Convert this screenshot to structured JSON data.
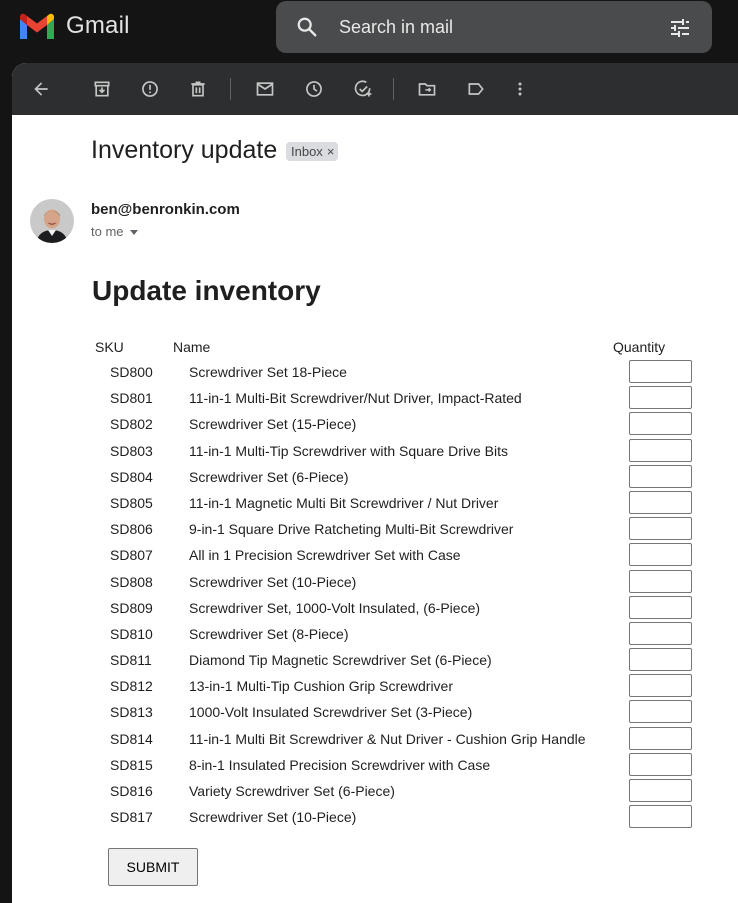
{
  "app": {
    "name": "Gmail",
    "brand_colors": [
      "#ea4335",
      "#4285f4",
      "#34a853",
      "#fbbc04",
      "#c5221f"
    ]
  },
  "search": {
    "placeholder": "Search in mail",
    "icon": "search-icon",
    "filter_icon": "tune-icon"
  },
  "toolbar": {
    "icons": [
      "back-arrow-icon",
      "archive-icon",
      "report-spam-icon",
      "delete-icon",
      "mark-unread-icon",
      "snooze-icon",
      "add-to-tasks-icon",
      "move-to-icon",
      "label-icon",
      "more-vert-icon"
    ]
  },
  "email": {
    "subject": "Inventory update",
    "label_chip": "Inbox",
    "label_chip_close": "×",
    "sender": "ben@benronkin.com",
    "recipient": "to me"
  },
  "form": {
    "heading": "Update inventory",
    "columns": {
      "sku": "SKU",
      "name": "Name",
      "quantity": "Quantity"
    },
    "items": [
      {
        "sku": "SD800",
        "name": "Screwdriver Set 18-Piece",
        "quantity": ""
      },
      {
        "sku": "SD801",
        "name": "11-in-1 Multi-Bit Screwdriver/Nut Driver, Impact-Rated",
        "quantity": ""
      },
      {
        "sku": "SD802",
        "name": "Screwdriver Set (15-Piece)",
        "quantity": ""
      },
      {
        "sku": "SD803",
        "name": "11-in-1 Multi-Tip Screwdriver with Square Drive Bits",
        "quantity": ""
      },
      {
        "sku": "SD804",
        "name": "Screwdriver Set (6-Piece)",
        "quantity": ""
      },
      {
        "sku": "SD805",
        "name": "11-in-1 Magnetic Multi Bit Screwdriver / Nut Driver",
        "quantity": ""
      },
      {
        "sku": "SD806",
        "name": "9-in-1 Square Drive Ratcheting Multi-Bit Screwdriver",
        "quantity": ""
      },
      {
        "sku": "SD807",
        "name": "All in 1 Precision Screwdriver Set with Case",
        "quantity": ""
      },
      {
        "sku": "SD808",
        "name": "Screwdriver Set (10-Piece)",
        "quantity": ""
      },
      {
        "sku": "SD809",
        "name": "Screwdriver Set, 1000-Volt Insulated, (6-Piece)",
        "quantity": ""
      },
      {
        "sku": "SD810",
        "name": "Screwdriver Set (8-Piece)",
        "quantity": ""
      },
      {
        "sku": "SD811",
        "name": "Diamond Tip Magnetic Screwdriver Set (6-Piece)",
        "quantity": ""
      },
      {
        "sku": "SD812",
        "name": "13-in-1 Multi-Tip Cushion Grip Screwdriver",
        "quantity": ""
      },
      {
        "sku": "SD813",
        "name": "1000-Volt Insulated Screwdriver Set (3-Piece)",
        "quantity": ""
      },
      {
        "sku": "SD814",
        "name": "11-in-1 Multi Bit Screwdriver & Nut Driver - Cushion Grip Handle",
        "quantity": ""
      },
      {
        "sku": "SD815",
        "name": "8-in-1 Insulated Precision Screwdriver with Case",
        "quantity": ""
      },
      {
        "sku": "SD816",
        "name": "Variety Screwdriver Set (6-Piece)",
        "quantity": ""
      },
      {
        "sku": "SD817",
        "name": "Screwdriver Set (10-Piece)",
        "quantity": ""
      }
    ],
    "submit_label": "SUBMIT"
  }
}
